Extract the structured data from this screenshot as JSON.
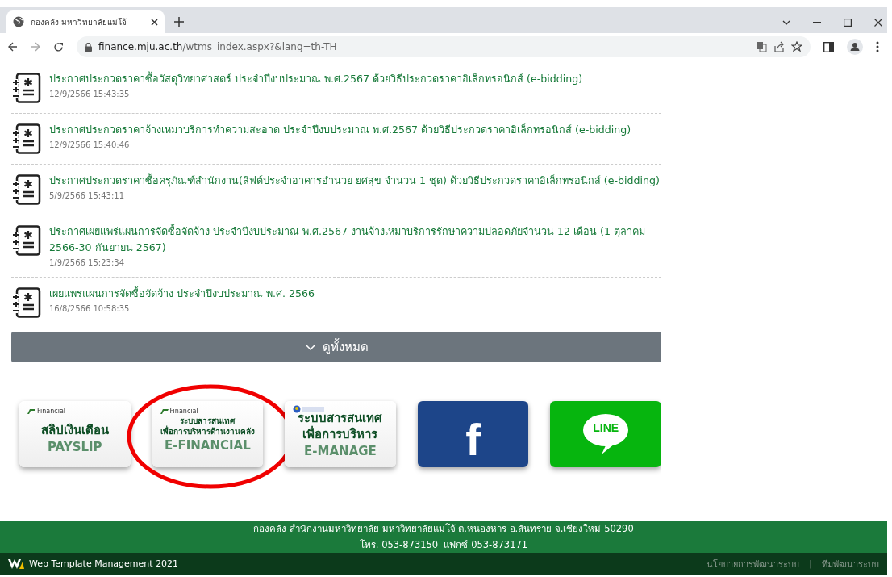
{
  "browser": {
    "tab": {
      "title": "กองคลัง มหาวิทยาลัยแม่โจ้",
      "selected": true
    },
    "url_host": "finance.mju.ac.th",
    "url_path": "/wtms_index.aspx?&lang=th-TH"
  },
  "announcements": [
    {
      "title": "ประกาศประกวดราคาซื้อวัสดุวิทยาศาสตร์ ประจำปีงบประมาณ พ.ศ.2567 ด้วยวิธีประกวดราคาอิเล็กทรอนิกส์ (e-bidding)",
      "date": "12/9/2566 15:43:35"
    },
    {
      "title": "ประกาศประกวดราคาจ้างเหมาบริการทำความสะอาด ประจำปีงบประมาณ พ.ศ.2567 ด้วยวิธีประกวดราคาอิเล็กทรอนิกส์ (e-bidding)",
      "date": "12/9/2566 15:40:46"
    },
    {
      "title": "ประกาศประกวดราคาซื้อครุภัณฑ์สำนักงาน(ลิฟต์ประจำอาคารอำนวย ยศสุข จำนวน 1 ชุด) ด้วยวิธีประกวดราคาอิเล็กทรอนิกส์ (e-bidding)",
      "date": "5/9/2566 15:43:11"
    },
    {
      "title": "ประกาศเผยแพร่แผนการจัดซื้อจัดจ้าง ประจำปีงบประมาณ พ.ศ.2567 งานจ้างเหมาบริการรักษาความปลอดภัยจำนวน 12 เดือน (1 ตุลาคม 2566-30 กันยายน 2567)",
      "date": "1/9/2566 15:23:34"
    },
    {
      "title": "เผยแพร่แผนการจัดซื้อจัดจ้าง ประจำปีงบประมาณ พ.ศ. 2566",
      "date": "16/8/2566 10:58:35"
    }
  ],
  "view_all_button": "ดูทั้งหมด",
  "banners": [
    {
      "kind": "system",
      "brand": "Financial",
      "lines": [
        "สลิปเงินเดือน"
      ],
      "caption": "PAYSLIP",
      "circled": false
    },
    {
      "kind": "system",
      "brand": "Financial",
      "lines": [
        "ระบบสารสนเทศ",
        "เพื่อการบริหารด้านงานคลัง"
      ],
      "caption": "E-FINANCIAL",
      "circled": true
    },
    {
      "kind": "system",
      "lines": [
        "ระบบสารสนเทศ",
        "เพื่อการบริหาร"
      ],
      "caption": "E-MANAGE",
      "circled": false
    },
    {
      "kind": "facebook",
      "mark": "f",
      "circled": false
    },
    {
      "kind": "line",
      "mark": "LINE",
      "circled": false
    }
  ],
  "footer": {
    "lines": [
      "กองคลัง สำนักงานมหาวิทยาลัย มหาวิทยาลัยแม่โจ้ ต.หนองหาร อ.สันทราย จ.เชียงใหม่ 50290",
      "โทร. 053-873150  แฟกซ์ 053-873171"
    ]
  },
  "bottom_bar": {
    "title": "Web Template Management 2021",
    "links": [
      "นโยบายการพัฒนาระบบ",
      "ทีมพัฒนาระบบ"
    ],
    "separator": "|"
  }
}
